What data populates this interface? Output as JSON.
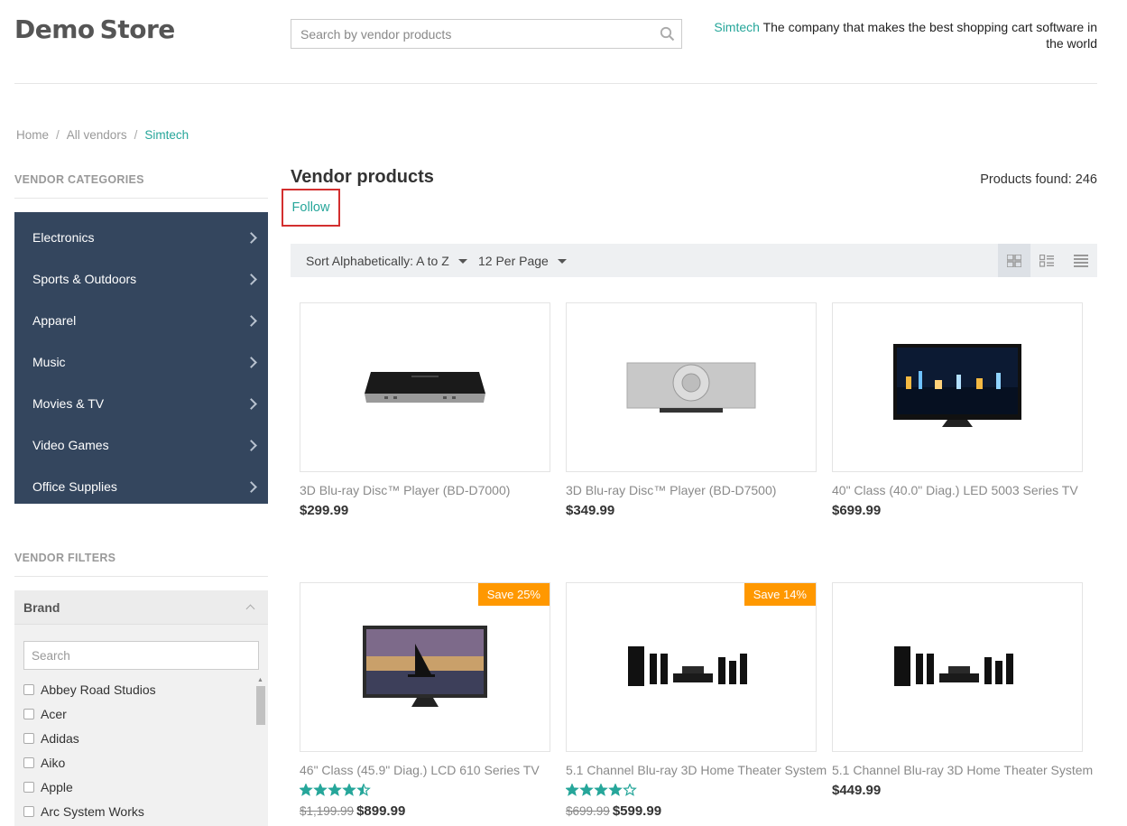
{
  "header": {
    "logo_word1": "Demo",
    "logo_word2": "Store",
    "search_placeholder": "Search by vendor products",
    "vendor_name": "Simtech",
    "vendor_description": "The company that makes the best shopping cart software in the world"
  },
  "breadcrumb": {
    "home": "Home",
    "all_vendors": "All vendors",
    "current": "Simtech",
    "separator": "/"
  },
  "sidebar": {
    "categories_title": "VENDOR CATEGORIES",
    "categories": [
      "Electronics",
      "Sports & Outdoors",
      "Apparel",
      "Music",
      "Movies & TV",
      "Video Games",
      "Office Supplies"
    ],
    "filters_title": "VENDOR FILTERS",
    "brand_title": "Brand",
    "brand_search_placeholder": "Search",
    "brands": [
      "Abbey Road Studios",
      "Acer",
      "Adidas",
      "Aiko",
      "Apple",
      "Arc System Works"
    ]
  },
  "main": {
    "title": "Vendor products",
    "follow_label": "Follow",
    "products_found": "Products found: 246",
    "sort_label": "Sort Alphabetically: A to Z",
    "per_page_label": "12 Per Page",
    "views": [
      "grid-view-icon",
      "list-view-icon",
      "compact-list-view-icon"
    ],
    "active_view": 0
  },
  "products": [
    {
      "name": "3D Blu-ray Disc™ Player (BD-D7000)",
      "price": "$299.99",
      "old_price": "",
      "badge": "",
      "rating": 0,
      "image": "blu-ray-player-black"
    },
    {
      "name": "3D Blu-ray Disc™ Player (BD-D7500)",
      "price": "$349.99",
      "old_price": "",
      "badge": "",
      "rating": 0,
      "image": "blu-ray-player-silver"
    },
    {
      "name": "40\" Class (40.0\" Diag.) LED 5003 Series TV",
      "price": "$699.99",
      "old_price": "",
      "badge": "",
      "rating": 0,
      "image": "tv-city-lights"
    },
    {
      "name": "46\" Class (45.9\" Diag.) LCD 610 Series TV",
      "price": "$899.99",
      "old_price": "$1,199.99",
      "badge": "Save 25%",
      "rating": 4.5,
      "image": "tv-sailboat-sunset"
    },
    {
      "name": "5.1 Channel Blu-ray 3D Home Theater System",
      "price": "$599.99",
      "old_price": "$699.99",
      "badge": "Save 14%",
      "rating": 4,
      "image": "home-theater-system"
    },
    {
      "name": "5.1 Channel Blu-ray 3D Home Theater System",
      "price": "$449.99",
      "old_price": "",
      "badge": "",
      "rating": 0,
      "image": "home-theater-system"
    }
  ],
  "colors": {
    "accent": "#26a69a",
    "sidebar_bg": "#34465e",
    "badge": "#ff9800",
    "follow_highlight": "#d32f2f"
  }
}
